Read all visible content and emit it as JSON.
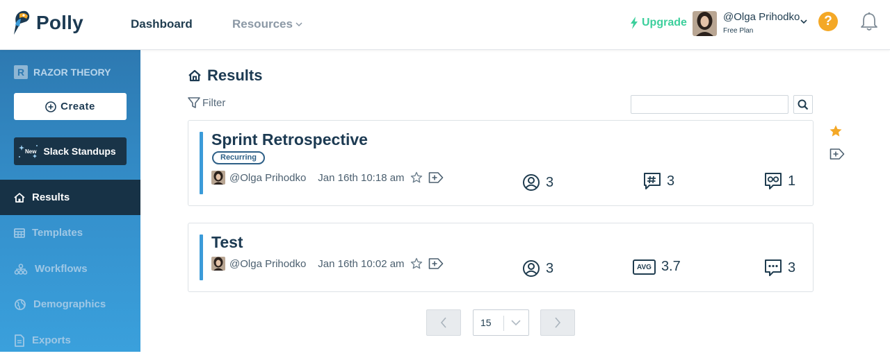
{
  "header": {
    "brand": "Polly",
    "nav": {
      "dashboard": "Dashboard",
      "resources": "Resources"
    },
    "upgrade": "Upgrade",
    "user": {
      "name": "@Olga Prihodko",
      "plan": "Free Plan"
    },
    "help": "?"
  },
  "sidebar": {
    "org": "RAZOR THEORY",
    "org_badge": "R",
    "create": "Create",
    "slack_new": "New",
    "slack": "Slack Standups",
    "items": [
      {
        "label": "Results",
        "icon": "home-icon",
        "active": true
      },
      {
        "label": "Templates",
        "icon": "table-icon",
        "active": false
      },
      {
        "label": "Workflows",
        "icon": "workflow-icon",
        "active": false
      },
      {
        "label": "Demographics",
        "icon": "globe-icon",
        "active": false
      },
      {
        "label": "Exports",
        "icon": "file-icon",
        "active": false
      }
    ]
  },
  "main": {
    "title": "Results",
    "filter": "Filter",
    "search_value": "",
    "cards": [
      {
        "title": "Sprint Retrospective",
        "badge": "Recurring",
        "author": "@Olga Prihodko",
        "date": "Jan 16th 10:18 am",
        "stats": [
          {
            "icon": "user-circle-icon",
            "value": "3"
          },
          {
            "icon": "hash-comment-icon",
            "value": "3"
          },
          {
            "icon": "infinity-comment-icon",
            "value": "1"
          }
        ]
      },
      {
        "title": "Test",
        "author": "@Olga Prihodko",
        "date": "Jan 16th 10:02 am",
        "stats": [
          {
            "icon": "user-circle-icon",
            "value": "3"
          },
          {
            "icon": "avg-badge",
            "label": "AVG",
            "value": "3.7"
          },
          {
            "icon": "comment-icon",
            "value": "3"
          }
        ]
      }
    ]
  },
  "pagination": {
    "page_size": "15"
  },
  "colors": {
    "accent": "#3b9bd9",
    "upgrade": "#3ccf9c",
    "help": "#f4a826",
    "star": "#f4a826",
    "sidebar_active": "#173246"
  }
}
